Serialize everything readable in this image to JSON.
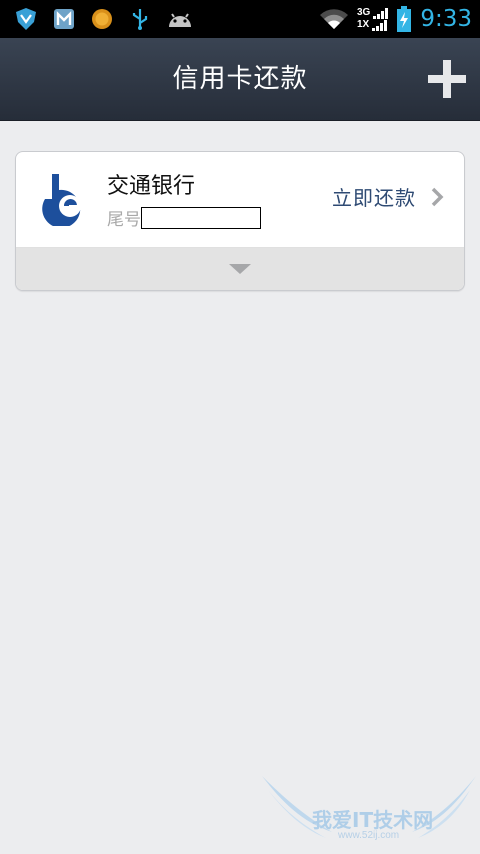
{
  "status_bar": {
    "time": "9:33",
    "network_top": "3G",
    "network_bottom": "1X",
    "icons": [
      "shield-icon",
      "m-app-icon",
      "orange-circle-icon",
      "usb-icon",
      "android-icon",
      "wifi-icon",
      "signal-icon",
      "battery-icon"
    ],
    "time_color": "#33b5e5"
  },
  "header": {
    "title": "信用卡还款",
    "add_icon": "plus-icon"
  },
  "card": {
    "bank_name": "交通银行",
    "tail_label": "尾号",
    "tail_value": "",
    "pay_label": "立即还款",
    "pay_color": "#2e4a73",
    "logo_icon": "bank-of-communications-logo",
    "logo_color": "#1d4f9c"
  },
  "watermark": {
    "text": "我爱IT技术网",
    "url": "www.52ij.com"
  }
}
